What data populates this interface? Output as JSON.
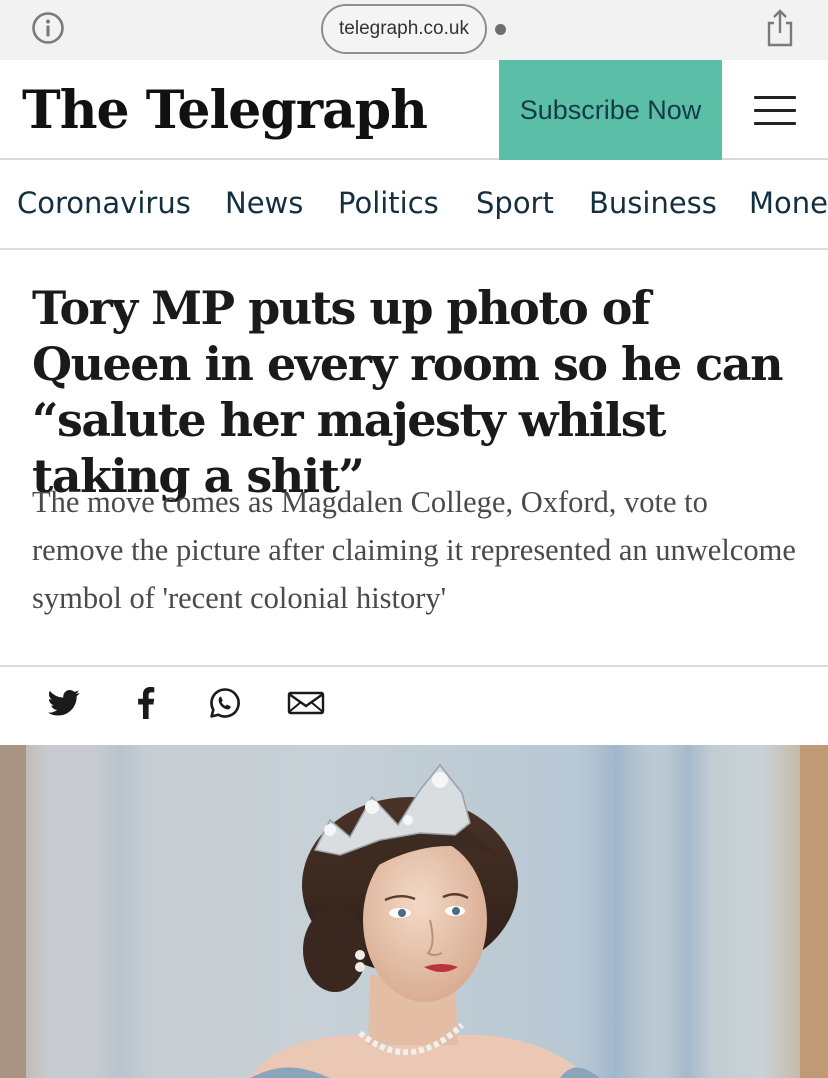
{
  "browser": {
    "url": "telegraph.co.uk",
    "info_icon": "info-icon",
    "share_icon": "share-icon"
  },
  "masthead": {
    "logo": "The Telegraph",
    "subscribe_label": "Subscribe Now",
    "menu_icon": "hamburger-menu-icon"
  },
  "nav": {
    "items": [
      {
        "label": "Coronavirus"
      },
      {
        "label": "News"
      },
      {
        "label": "Politics"
      },
      {
        "label": "Sport"
      },
      {
        "label": "Business"
      },
      {
        "label": "Mone"
      }
    ]
  },
  "article": {
    "headline": "Tory MP puts up photo of Queen in every room so he can “salute her majesty whilst taking a shit”",
    "standfirst": "The move comes as Magdalen College, Oxford, vote to remove the picture after claiming it represented an unwelcome symbol of 'recent colonial history'"
  },
  "share": {
    "icons": [
      "twitter-icon",
      "facebook-icon",
      "whatsapp-icon",
      "email-icon"
    ]
  },
  "colors": {
    "subscribe_bg": "#5bbfa8",
    "nav_text": "#142f3f",
    "browser_bar": "#f2f2f2"
  }
}
